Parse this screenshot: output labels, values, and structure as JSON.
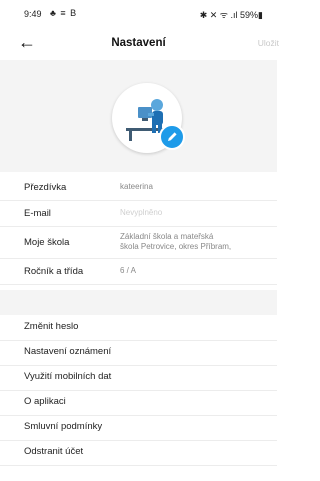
{
  "status_bar": {
    "time": "9:49",
    "left_icons": "♣ ≡ B",
    "right_icons": "✱ ✕ ᯤ .ıl 59%▮"
  },
  "header": {
    "back_icon": "arrow-left-icon",
    "title": "Nastavení",
    "save_label": "Uložit"
  },
  "profile": {
    "avatar_icon": "person-at-desk-avatar",
    "edit_icon": "pencil-icon",
    "accent_color": "#1e9be9"
  },
  "fields": [
    {
      "label": "Přezdívka",
      "value": "kateerina"
    },
    {
      "label": "E-mail",
      "value": "Nevyplněno"
    },
    {
      "label": "Moje škola",
      "value_line1": "Základní škola a mateřská",
      "value_line2": "škola Petrovice, okres Příbram,"
    },
    {
      "label": "Ročník a třída",
      "value": "6 / A"
    }
  ],
  "menu": [
    "Změnit heslo",
    "Nastavení oznámení",
    "Využití mobilních dat",
    "O aplikaci",
    "Smluvní podmínky",
    "Odstranit účet"
  ]
}
